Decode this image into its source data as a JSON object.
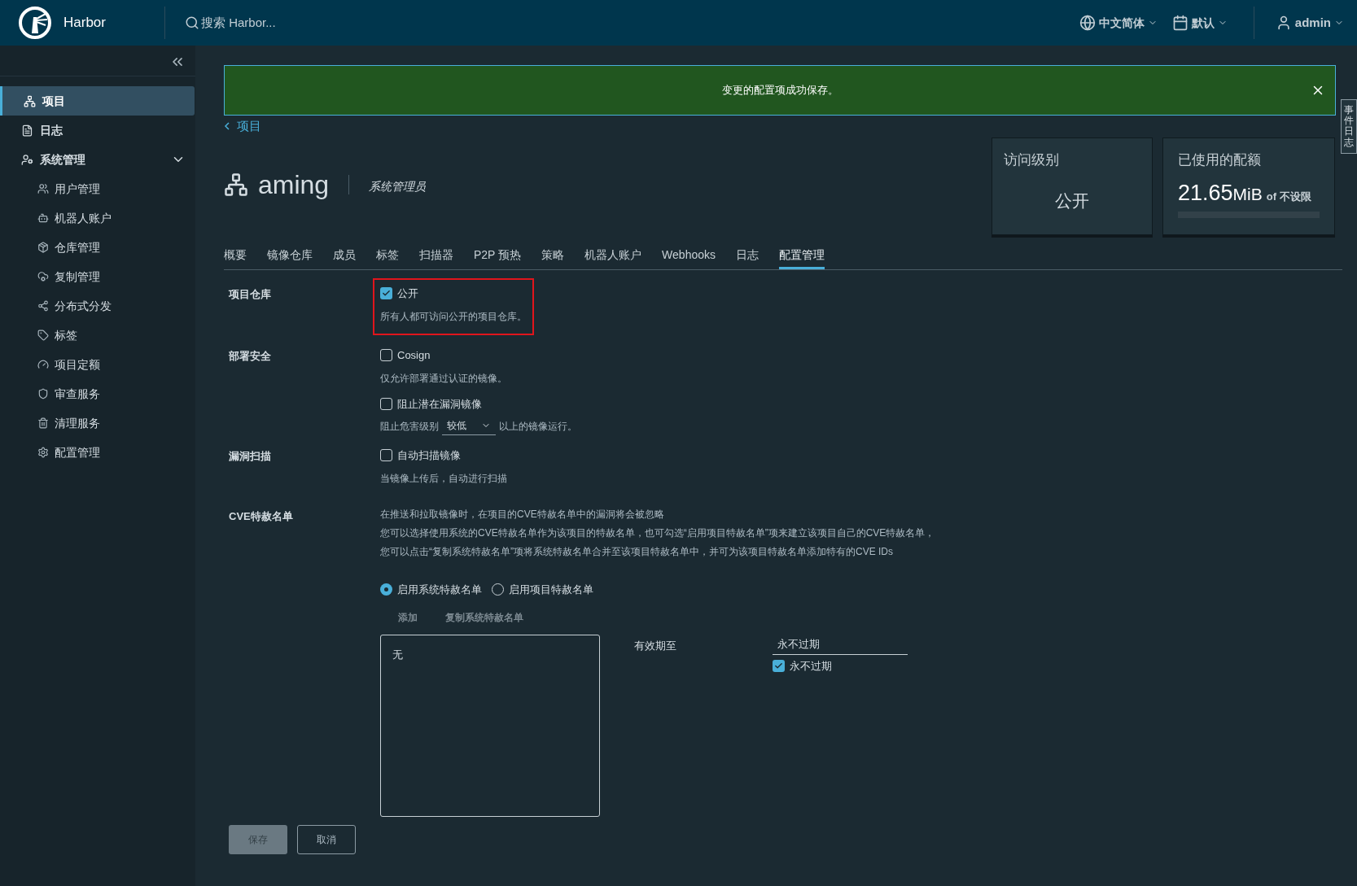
{
  "header": {
    "brand": "Harbor",
    "search_placeholder": "搜索 Harbor...",
    "language": "中文简体",
    "date_format": "默认",
    "user": "admin"
  },
  "sidebar": {
    "items": [
      {
        "label": "项目",
        "selected": true
      },
      {
        "label": "日志",
        "selected": false
      },
      {
        "label": "系统管理",
        "selected": false,
        "expanded": true,
        "children": [
          {
            "label": "用户管理",
            "selected": false
          },
          {
            "label": "机器人账户",
            "selected": false
          },
          {
            "label": "仓库管理",
            "selected": false
          },
          {
            "label": "复制管理",
            "selected": false
          },
          {
            "label": "分布式分发",
            "selected": false
          },
          {
            "label": "标签",
            "selected": false
          },
          {
            "label": "项目定额",
            "selected": false
          },
          {
            "label": "审查服务",
            "selected": false
          },
          {
            "label": "清理服务",
            "selected": false
          },
          {
            "label": "配置管理",
            "selected": false
          }
        ]
      }
    ]
  },
  "banner": {
    "message": "变更的配置项成功保存。"
  },
  "breadcrumb": "项目",
  "project": {
    "name": "aming",
    "role": "系统管理员"
  },
  "access_card": {
    "title": "访问级别",
    "value": "公开"
  },
  "quota_card": {
    "title": "已使用的配额",
    "used": "21.65",
    "unit": "MiB",
    "of": "of",
    "limit": "不设限"
  },
  "tabs": [
    {
      "label": "概要",
      "selected": false
    },
    {
      "label": "镜像仓库",
      "selected": false
    },
    {
      "label": "成员",
      "selected": false
    },
    {
      "label": "标签",
      "selected": false
    },
    {
      "label": "扫描器",
      "selected": false
    },
    {
      "label": "P2P 预热",
      "selected": false
    },
    {
      "label": "策略",
      "selected": false
    },
    {
      "label": "机器人账户",
      "selected": false
    },
    {
      "label": "Webhooks",
      "selected": false
    },
    {
      "label": "日志",
      "selected": false
    },
    {
      "label": "配置管理",
      "selected": true
    }
  ],
  "form": [
    {
      "label": "项目仓库",
      "highlighted": true,
      "items": [
        {
          "kind": "checkbox",
          "label": "公开",
          "checked": true
        },
        {
          "kind": "help",
          "text": "所有人都可访问公开的项目仓库。"
        }
      ]
    },
    {
      "label": "部署安全",
      "highlighted": false,
      "items": [
        {
          "kind": "checkbox",
          "label": "Cosign",
          "checked": false
        },
        {
          "kind": "help",
          "text": "仅允许部署通过认证的镜像。"
        },
        {
          "kind": "checkbox",
          "label": "阻止潜在漏洞镜像",
          "checked": false
        },
        {
          "kind": "severity",
          "prefix": "阻止危害级别",
          "value": "较低",
          "suffix": "以上的镜像运行。"
        }
      ]
    },
    {
      "label": "漏洞扫描",
      "highlighted": false,
      "items": [
        {
          "kind": "checkbox",
          "label": "自动扫描镜像",
          "checked": false
        },
        {
          "kind": "help",
          "text": "当镜像上传后，自动进行扫描"
        }
      ]
    },
    {
      "label": "CVE特赦名单",
      "highlighted": false,
      "items": [
        {
          "kind": "paragraph",
          "lines": [
            "在推送和拉取镜像时，在项目的CVE特赦名单中的漏洞将会被忽略",
            "您可以选择使用系统的CVE特赦名单作为该项目的特赦名单，也可勾选“启用项目特赦名单”项来建立该项目自己的CVE特赦名单，",
            "您可以点击“复制系统特赦名单”项将系统特赦名单合并至该项目特赦名单中，并可为该项目特赦名单添加特有的CVE IDs"
          ]
        },
        {
          "kind": "radios",
          "options": [
            {
              "label": "启用系统特赦名单",
              "selected": true
            },
            {
              "label": "启用项目特赦名单",
              "selected": false
            }
          ]
        },
        {
          "kind": "actions",
          "buttons": [
            {
              "label": "添加",
              "disabled": true
            },
            {
              "label": "复制系统特赦名单",
              "disabled": true
            }
          ]
        },
        {
          "kind": "allowlist",
          "entries": [
            "无"
          ],
          "expiry_label": "有效期至",
          "expiry_value": "永不过期",
          "never_label": "永不过期",
          "never_checked": true
        }
      ]
    }
  ],
  "buttons": [
    {
      "label": "保存",
      "disabled": true
    },
    {
      "label": "取消",
      "disabled": false
    }
  ],
  "side_tab": "事件日志"
}
